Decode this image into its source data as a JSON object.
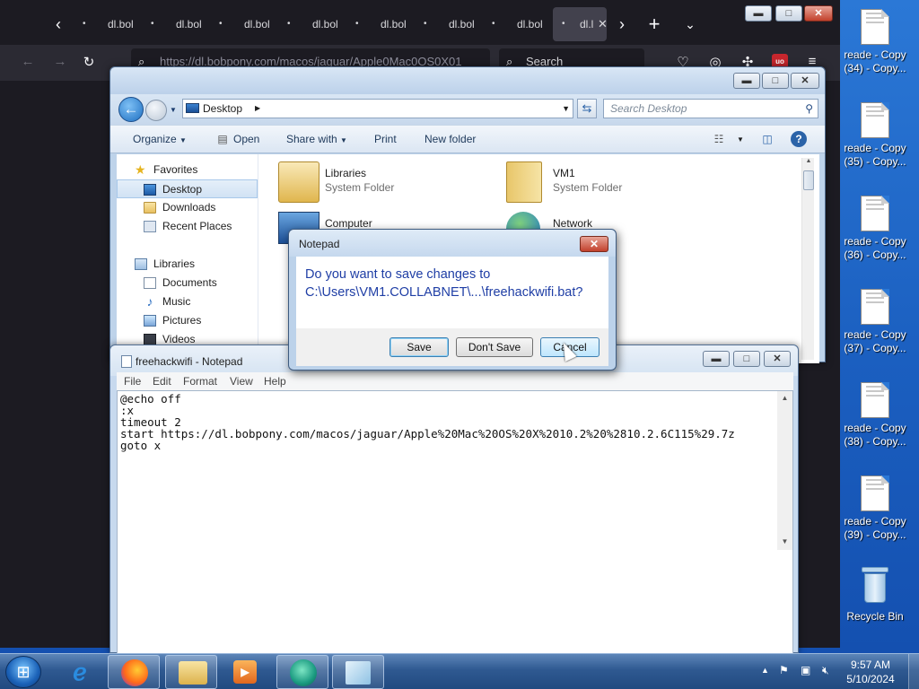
{
  "browser": {
    "tabs": [
      {
        "label": "dl.bol",
        "active": false
      },
      {
        "label": "dl.bol",
        "active": false
      },
      {
        "label": "dl.bol",
        "active": false
      },
      {
        "label": "dl.bol",
        "active": false
      },
      {
        "label": "dl.bol",
        "active": false
      },
      {
        "label": "dl.bol",
        "active": false
      },
      {
        "label": "dl.bol",
        "active": false
      },
      {
        "label": "dl.l",
        "active": true
      }
    ],
    "url": "https://dl.bobpony.com/macos/jaguar/Apple0Mac0OS0X01",
    "search_label": "Search",
    "ublock_badge": "uo"
  },
  "explorer": {
    "address": "Desktop",
    "search_placeholder": "Search Desktop",
    "toolbar": {
      "organize": "Organize",
      "open": "Open",
      "share_with": "Share with",
      "print": "Print",
      "new_folder": "New folder"
    },
    "nav": {
      "favorites": "Favorites",
      "desktop": "Desktop",
      "downloads": "Downloads",
      "recent_places": "Recent Places",
      "libraries": "Libraries",
      "documents": "Documents",
      "music": "Music",
      "pictures": "Pictures",
      "videos": "Videos"
    },
    "items": {
      "libraries": {
        "name": "Libraries",
        "type": "System Folder"
      },
      "vm1": {
        "name": "VM1",
        "type": "System Folder"
      },
      "computer": {
        "name": "Computer"
      },
      "network": {
        "name": "Network"
      }
    }
  },
  "notepad": {
    "title": "freehackwifi - Notepad",
    "menu": [
      "File",
      "Edit",
      "Format",
      "View",
      "Help"
    ],
    "content": "@echo off\n:x\ntimeout 2\nstart https://dl.bobpony.com/macos/jaguar/Apple%20Mac%20OS%20X%2010.2%20%2810.2.6C115%29.7z\ngoto x"
  },
  "dialog": {
    "title": "Notepad",
    "message_line1": "Do you want to save changes to",
    "message_line2": "C:\\Users\\VM1.COLLABNET\\...\\freehackwifi.bat?",
    "save": "Save",
    "dont_save": "Don't Save",
    "cancel": "Cancel"
  },
  "desktop_icons": [
    {
      "line1": "reade - Copy",
      "line2": "(34) - Copy..."
    },
    {
      "line1": "reade - Copy",
      "line2": "(35) - Copy..."
    },
    {
      "line1": "reade - Copy",
      "line2": "(36) - Copy..."
    },
    {
      "line1": "reade - Copy",
      "line2": "(37) - Copy..."
    },
    {
      "line1": "reade - Copy",
      "line2": "(38) - Copy..."
    },
    {
      "line1": "reade - Copy",
      "line2": "(39) - Copy..."
    }
  ],
  "recycle_bin": "Recycle Bin",
  "clock": {
    "time": "9:57 AM",
    "date": "5/10/2024"
  },
  "icons": [
    "back-arrow-icon",
    "forward-arrow-icon",
    "reload-icon",
    "search-icon",
    "pocket-icon",
    "account-icon",
    "extensions-icon",
    "ublock-icon",
    "menu-icon",
    "firefox-icon",
    "ie-icon",
    "explorer-icon",
    "media-player-icon",
    "notepad-icon"
  ]
}
